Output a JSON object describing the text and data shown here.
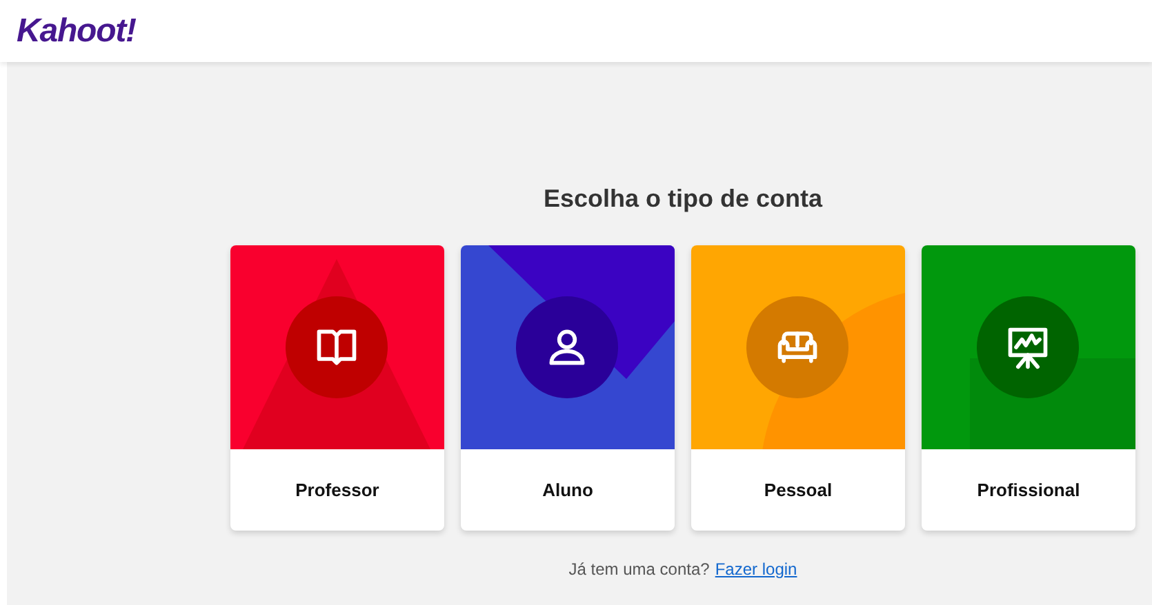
{
  "header": {
    "logo": "Kahoot!"
  },
  "title": "Escolha o tipo de conta",
  "account_types": [
    {
      "label": "Professor",
      "kind": "book",
      "color": "#f9002e"
    },
    {
      "label": "Aluno",
      "kind": "person",
      "color": "#3547d0"
    },
    {
      "label": "Pessoal",
      "kind": "sofa",
      "color": "#ffa602"
    },
    {
      "label": "Profissional",
      "kind": "presentation",
      "color": "#01980d"
    }
  ],
  "footer": {
    "text": "Já tem uma conta?",
    "link": "Fazer login"
  }
}
